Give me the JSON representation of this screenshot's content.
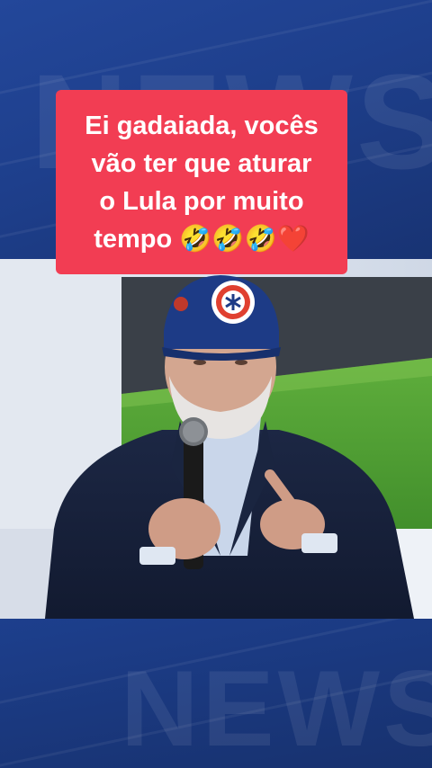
{
  "caption": {
    "text": "Ei gadaiada, vocês\nvão ter que aturar\no Lula por muito\ntempo 🤣🤣🤣❤️"
  },
  "watermark": {
    "top_text": "NEWS",
    "bottom_text": "NEWS"
  },
  "colors": {
    "caption_bg": "#f23d53",
    "frame_blue": "#1e3f8c"
  }
}
